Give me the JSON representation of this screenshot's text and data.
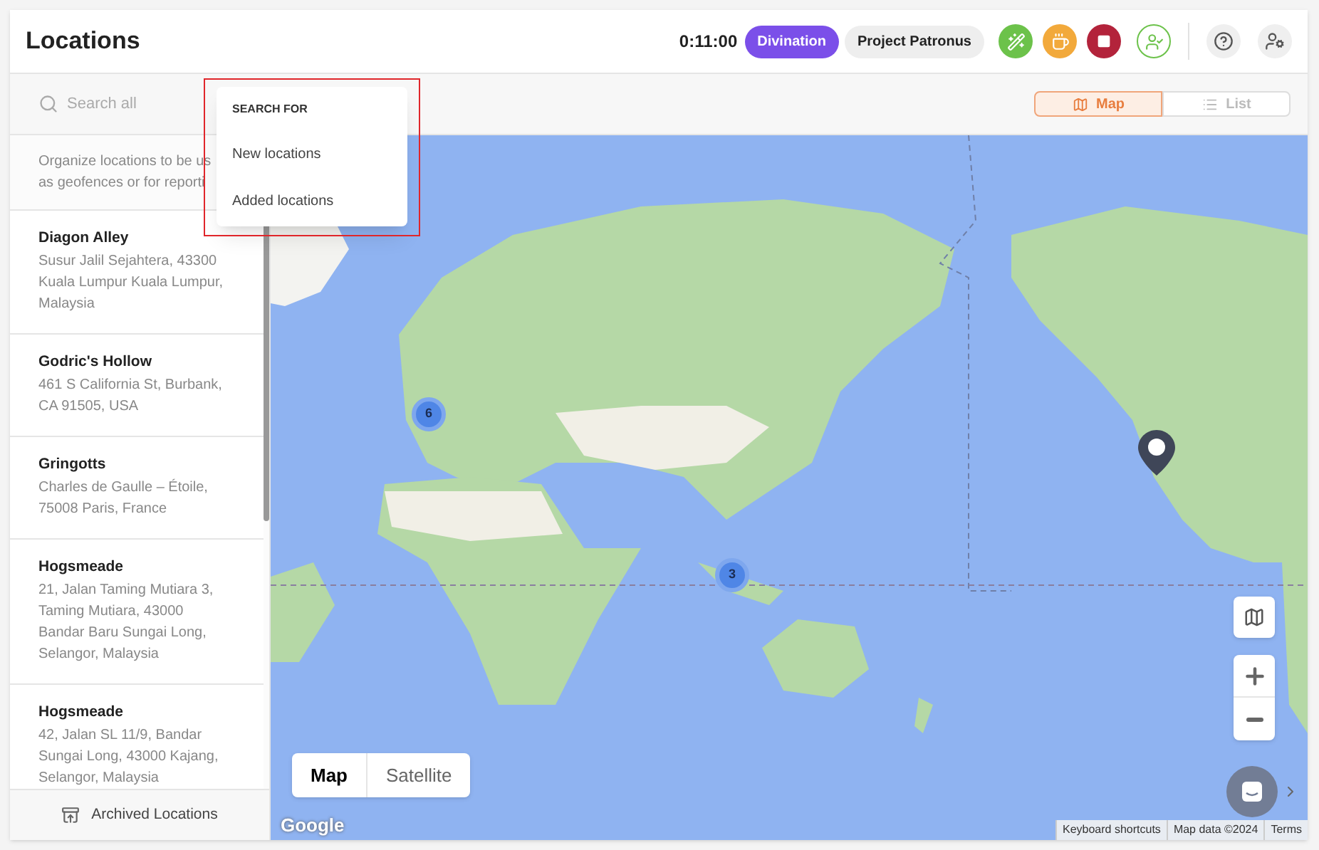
{
  "header": {
    "title": "Locations",
    "timer": "0:11:00",
    "tags": [
      {
        "label": "Divination",
        "color": "#7b4fe9"
      },
      {
        "label": "Project Patronus",
        "color": "#eeeeee"
      }
    ]
  },
  "toolbar": {
    "search": {
      "placeholder": "Search all"
    },
    "view_toggle": [
      {
        "label": "Map",
        "selected": true
      },
      {
        "label": "List",
        "selected": false
      }
    ]
  },
  "search_menu": {
    "heading": "SEARCH FOR",
    "options": [
      "New locations",
      "Added locations"
    ]
  },
  "sidebar": {
    "intro_lines": [
      "Organize locations to be us",
      "as geofences or for reporti"
    ],
    "locations": [
      {
        "name": "Diagon Alley",
        "address": "Susur Jalil Sejahtera, 43300 Kuala Lumpur Kuala Lumpur, Malaysia"
      },
      {
        "name": "Godric's Hollow",
        "address": "461 S California St, Burbank, CA 91505, USA"
      },
      {
        "name": "Gringotts",
        "address": "Charles de Gaulle – Étoile, 75008 Paris, France"
      },
      {
        "name": "Hogsmeade",
        "address": "21, Jalan Taming Mutiara 3, Taming Mutiara, 43000 Bandar Baru Sungai Long, Selangor, Malaysia"
      },
      {
        "name": "Hogsmeade",
        "address": "42, Jalan SL 11/9, Bandar Sungai Long, 43000 Kajang, Selangor, Malaysia"
      }
    ],
    "archived_button": "Archived Locations"
  },
  "map": {
    "clusters": [
      {
        "count": "6"
      },
      {
        "count": "3"
      }
    ],
    "map_type": [
      {
        "label": "Map",
        "selected": true
      },
      {
        "label": "Satellite",
        "selected": false
      }
    ],
    "logo": "Google",
    "attributions": [
      "Keyboard shortcuts",
      "Map data ©2024",
      "Terms"
    ]
  }
}
